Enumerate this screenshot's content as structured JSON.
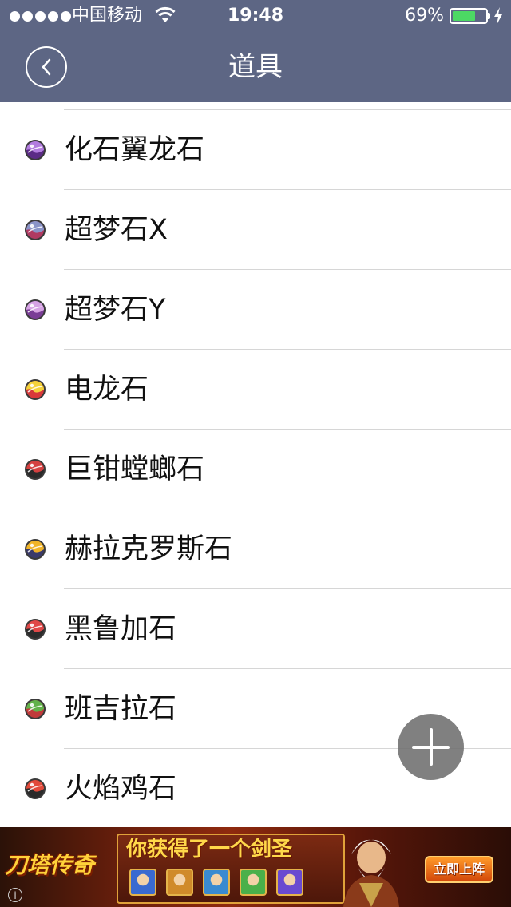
{
  "status_bar": {
    "carrier": "中国移动",
    "time": "19:48",
    "battery": "69%",
    "battery_level": 0.69,
    "signal_bars": 5
  },
  "nav": {
    "title": "道具",
    "back_icon": "chevron-left-icon"
  },
  "items": [
    {
      "label": "化石翼龙石",
      "icon": "mega-stone-icon",
      "colors": [
        "#b37ddf",
        "#5b2b86"
      ]
    },
    {
      "label": "超梦石X",
      "icon": "mega-stone-icon",
      "colors": [
        "#8a94c8",
        "#b03a62"
      ]
    },
    {
      "label": "超梦石Y",
      "icon": "mega-stone-icon",
      "colors": [
        "#d6a3e4",
        "#7a3d96"
      ]
    },
    {
      "label": "电龙石",
      "icon": "mega-stone-icon",
      "colors": [
        "#f4d23a",
        "#d8383a"
      ]
    },
    {
      "label": "巨钳螳螂石",
      "icon": "mega-stone-icon",
      "colors": [
        "#d44040",
        "#2a2a2a"
      ]
    },
    {
      "label": "赫拉克罗斯石",
      "icon": "mega-stone-icon",
      "colors": [
        "#f0b428",
        "#3a3a6a"
      ]
    },
    {
      "label": "黑鲁加石",
      "icon": "mega-stone-icon",
      "colors": [
        "#e04848",
        "#2b2b2b"
      ]
    },
    {
      "label": "班吉拉石",
      "icon": "mega-stone-icon",
      "colors": [
        "#62b24a",
        "#c03a3a"
      ]
    },
    {
      "label": "火焰鸡石",
      "icon": "mega-stone-icon",
      "colors": [
        "#e24a3a",
        "#2b2b2b"
      ]
    }
  ],
  "fab": {
    "icon": "plus-icon"
  },
  "ad": {
    "logo_text": "刀塔传奇",
    "headline": "你获得了一个剑圣",
    "cta": "立即上阵",
    "hero_colors": [
      "#3a6ad0",
      "#d08a2a",
      "#3a8ad0",
      "#4ab04a",
      "#6a4ad0"
    ]
  }
}
